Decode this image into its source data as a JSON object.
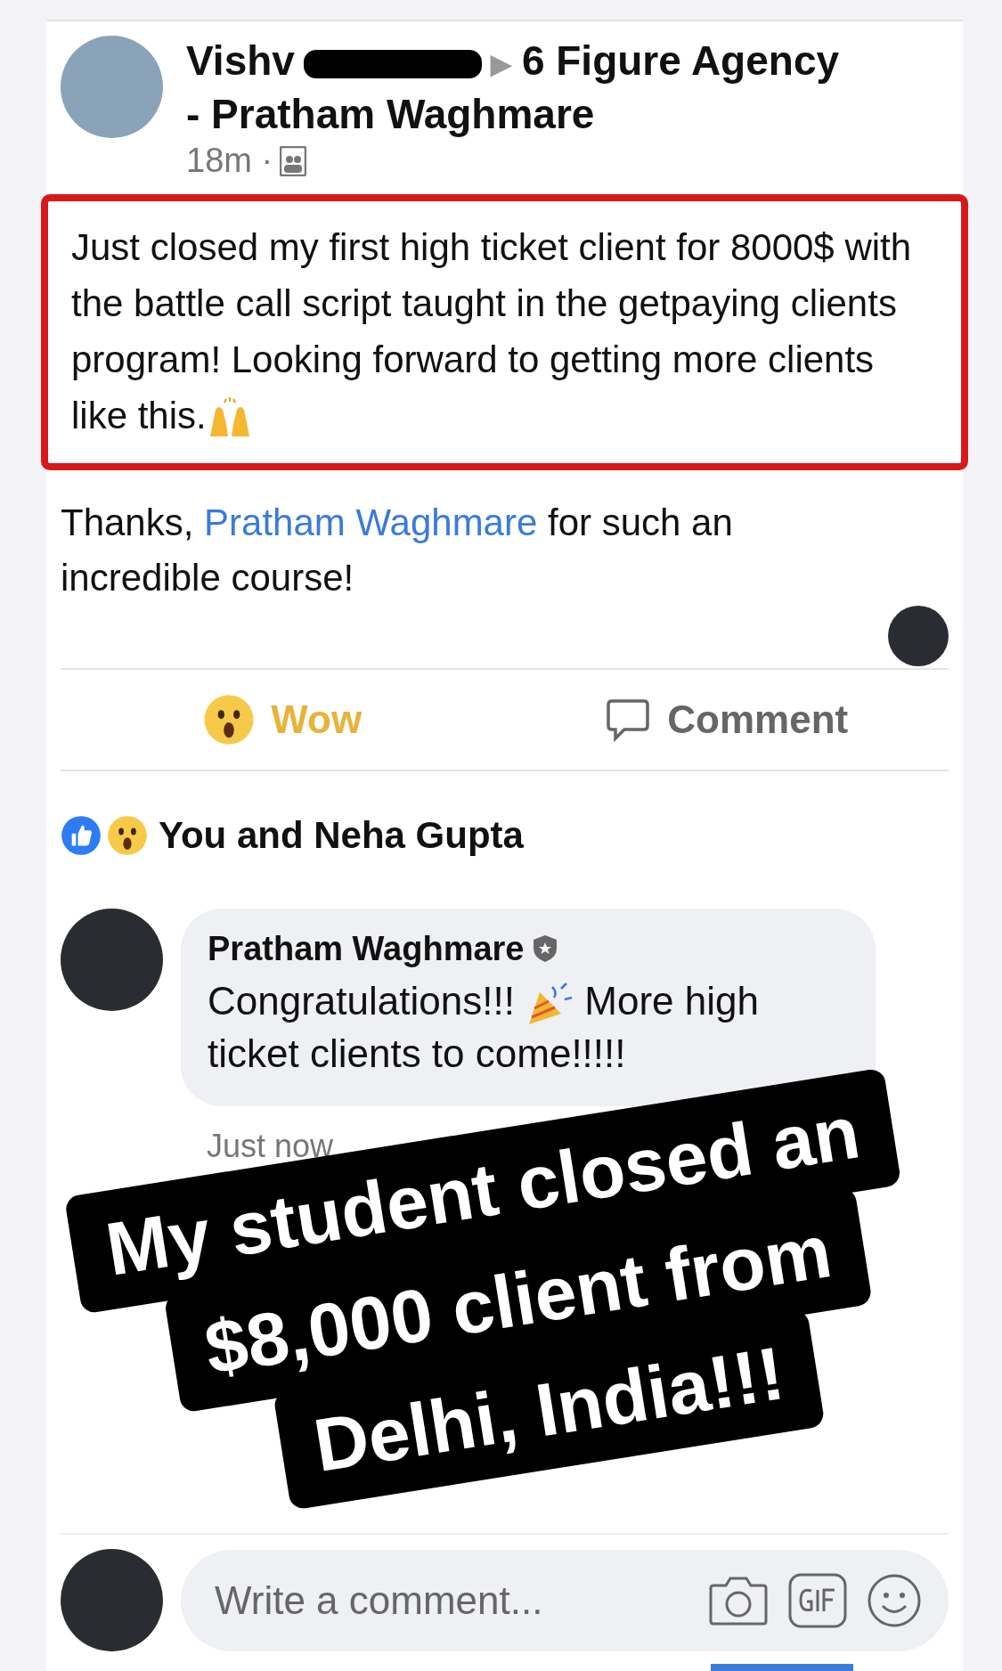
{
  "post": {
    "author": "Vishv",
    "audience_arrow": "▶",
    "group_lines": [
      "6 Figure Agency",
      "- Pratham Waghmare"
    ],
    "time": "18m ·",
    "highlighted_text": "Just closed my first high ticket client for 8000$ with the battle call script taught in the getpaying clients program! Looking forward to getting more clients like this.",
    "thanks_before": "Thanks, ",
    "thanks_link": "Pratham Waghmare",
    "thanks_after": " for such an incredible course!"
  },
  "actions": [
    {
      "kind": "wow",
      "label": "Wow",
      "selected": true
    },
    {
      "kind": "comment",
      "label": "Comment",
      "selected": false
    }
  ],
  "reactions_summary": "You and Neha Gupta",
  "comment": {
    "author": "Pratham Waghmare",
    "text_before": "Congratulations!!!",
    "text_after": "More high ticket clients to come!!!!!",
    "time": "Just now"
  },
  "overlay_caption": [
    "My student closed an",
    "$8,000 client from",
    "Delhi, India!!!"
  ],
  "composer": {
    "placeholder": "Write a comment..."
  }
}
